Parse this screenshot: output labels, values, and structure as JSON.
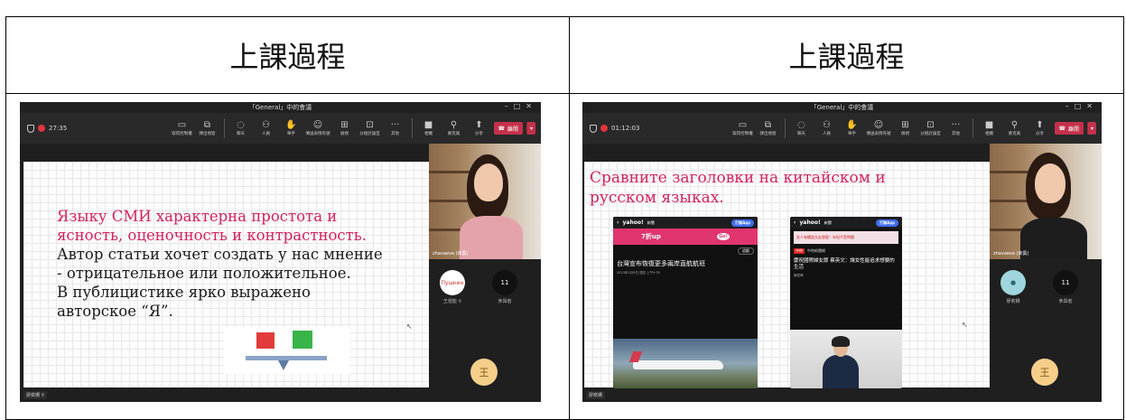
{
  "headings": {
    "left": "上課過程",
    "right": "上課過程"
  },
  "left_window": {
    "title": "「General」中的會議",
    "timer": "27:35",
    "tools": [
      {
        "icon": "screen-share-icon",
        "label": "取得控制權"
      },
      {
        "icon": "popout-icon",
        "label": "彈出視窗"
      },
      {
        "icon": "chat-icon",
        "label": "聊天"
      },
      {
        "icon": "people-icon",
        "label": "人員"
      },
      {
        "icon": "raise-hand-icon",
        "label": "舉手"
      },
      {
        "icon": "reactions-icon",
        "label": "傳送表情符號"
      },
      {
        "icon": "view-icon",
        "label": "檢視"
      },
      {
        "icon": "breakout-icon",
        "label": "分組討論室"
      },
      {
        "icon": "more-icon",
        "label": "其他"
      }
    ],
    "media": [
      {
        "icon": "camera-icon",
        "label": "相機"
      },
      {
        "icon": "mic-off-icon",
        "label": "麥克風"
      },
      {
        "icon": "share-icon",
        "label": "分享"
      }
    ],
    "leave_label": "離開",
    "slide": {
      "lines": [
        "Языку СМИ характерна простота и",
        "ясность, оценочность и контрастность.",
        "Автор статьи хочет создать у нас мнение",
        "- отрицательное или положительное.",
        "В публицистике ярко выражено",
        "авторское “Я”."
      ]
    },
    "presenter_name": "zhavaeva (來賓)",
    "tile1_name": "王煜能",
    "tile1_badge": "Пушкин",
    "tile2_count": "11",
    "tile2_label": "參與者",
    "avatar_initial": "王",
    "bottom_name": "廖奕姍"
  },
  "right_window": {
    "title": "「General」中的會議",
    "timer": "01:12:03",
    "leave_label": "離開",
    "slide": {
      "lines": [
        "Сравните заголовки на китайском и",
        "русском языках."
      ]
    },
    "ss1": {
      "brand": "yahoo!",
      "section": "新聞",
      "open_app": "打開App",
      "ad_text": "7折up",
      "ad_go": "Go!",
      "tag": "追蹤",
      "title": "台灣宣布恢復更多兩岸直航航班",
      "meta": "2023年2月9日 週四 上午9:35"
    },
    "ss2": {
      "brand": "yahoo!",
      "section": "新聞",
      "open_app": "打開App",
      "banner": "女人有權談交友戀愛！年紀不是問題",
      "source": "中時新聞網",
      "title": "蔡英文:讓女性能追求想要的生活",
      "title_full": "慶祝國際婦女節 蔡英文：讓女性能追求想要的生活",
      "author": "陳君瑋"
    },
    "presenter_name": "zhavaeva (來賓)",
    "tile1_name": "廖奕姍",
    "tile2_count": "11",
    "tile2_label": "參與者",
    "avatar_initial": "王",
    "bottom_name": "廖奕姍"
  }
}
